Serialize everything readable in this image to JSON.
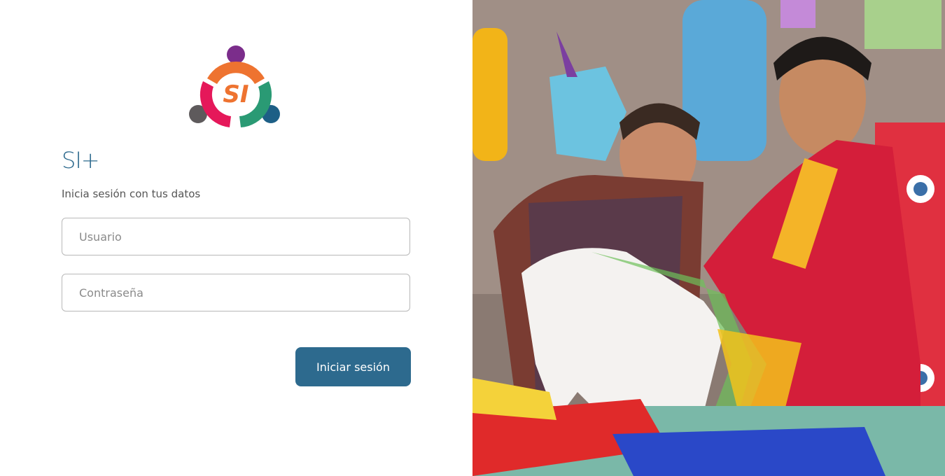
{
  "login": {
    "app_title": "SI+",
    "subtitle": "Inicia sesión con tus datos",
    "username_placeholder": "Usuario",
    "password_placeholder": "Contraseña",
    "submit_label": "Iniciar sesión"
  },
  "logo": {
    "text": "SI",
    "colors": {
      "purple": "#7b2d8b",
      "orange": "#ee7330",
      "magenta": "#e5185a",
      "green": "#2a9a74",
      "gray": "#5e5a5c",
      "blue": "#1d5f86"
    }
  },
  "theme": {
    "primary": "#2d6a8e"
  }
}
